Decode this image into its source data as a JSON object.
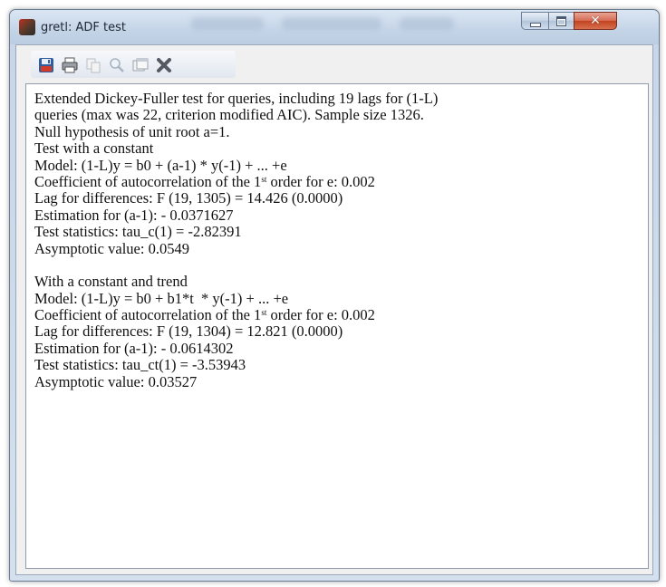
{
  "window": {
    "title": "gretl: ADF test",
    "controls": {
      "minimize_icon": "minimize-icon",
      "maximize_icon": "maximize-icon",
      "close_glyph": "✕"
    }
  },
  "toolbar": {
    "buttons": [
      {
        "name": "save-icon",
        "tooltip": ""
      },
      {
        "name": "print-icon",
        "tooltip": ""
      },
      {
        "name": "copy-icon",
        "tooltip": ""
      },
      {
        "name": "find-icon",
        "tooltip": ""
      },
      {
        "name": "edit-icon",
        "tooltip": ""
      },
      {
        "name": "close-icon",
        "tooltip": ""
      }
    ]
  },
  "output": {
    "intro": [
      "Extended Dickey-Fuller test for queries, including 19 lags for (1-L)",
      "queries (max was 22, criterion modified AIC). Sample size 1326.",
      "Null hypothesis of unit root a=1."
    ],
    "constant": {
      "heading": "Test with a constant",
      "model": "Model: (1-L)y = b0 + (a-1) * y(-1) + ... +e",
      "autocorr_prefix": "Coefficient of autocorrelation of the 1",
      "autocorr_sup": "st",
      "autocorr_suffix": " order for e: 0.002",
      "lag": "Lag for differences: F (19, 1305) = 14.426 (0.0000)",
      "estimation": "Estimation for (a-1): - 0.0371627",
      "statistic": "Test statistics: tau_c(1) = -2.82391",
      "asymptotic": "Asymptotic value: 0.0549"
    },
    "trend": {
      "heading": "With a constant and trend",
      "model": "Model: (1-L)y = b0 + b1*t  * y(-1) + ... +e",
      "autocorr_prefix": "Coefficient of autocorrelation of the 1",
      "autocorr_sup": "st",
      "autocorr_suffix": " order for e: 0.002",
      "lag": "Lag for differences: F (19, 1304) = 12.821 (0.0000)",
      "estimation": "Estimation for (a-1): - 0.0614302",
      "statistic": "Test statistics: tau_ct(1) = -3.53943",
      "asymptotic": "Asymptotic value: 0.03527"
    }
  }
}
